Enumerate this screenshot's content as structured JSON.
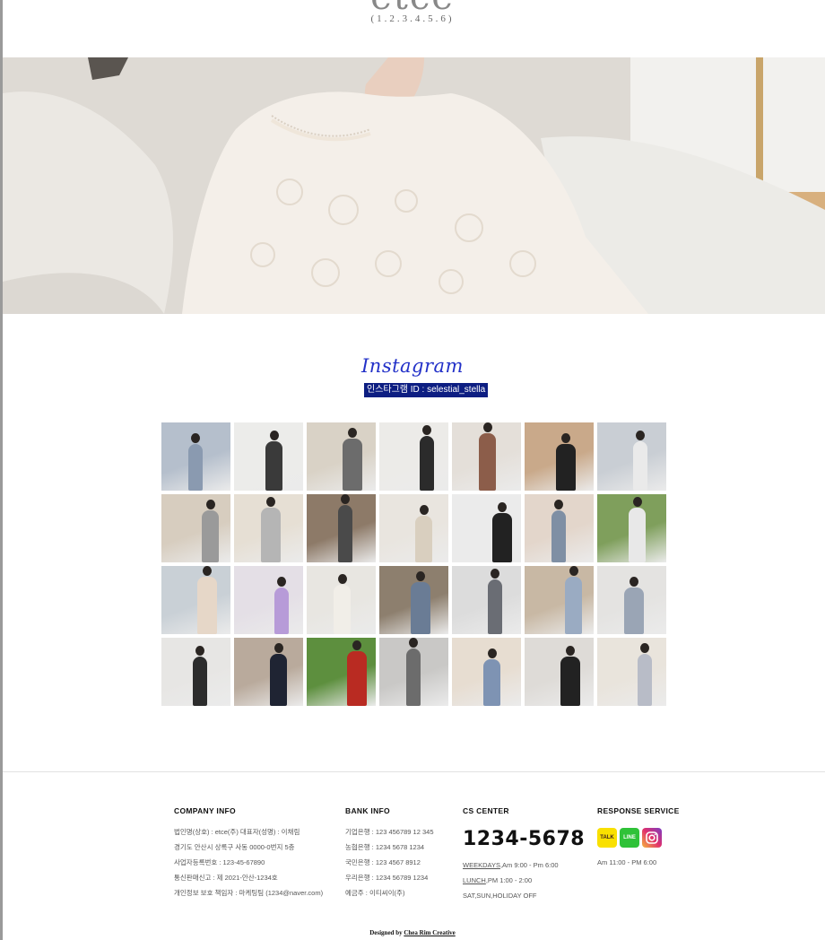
{
  "header": {
    "title": "etce",
    "subtitle": "(1.2.3.4.5.6)"
  },
  "hero": {
    "alt": "model in white lace blouse"
  },
  "instagram": {
    "title": "Instagram",
    "id_label": "인스타그램 ID : selestial_stella",
    "photos": [
      [
        "#b5bfcc",
        "#8a9ab0"
      ],
      [
        "#ececea",
        "#3a3a3a"
      ],
      [
        "#d9d2c6",
        "#6c6c6c"
      ],
      [
        "#ecebe8",
        "#2b2b2b"
      ],
      [
        "#e4dfd9",
        "#8c5d4a"
      ],
      [
        "#c9a98a",
        "#222"
      ],
      [
        "#c9ced4",
        "#eaeaea"
      ],
      [
        "#d7cdbf",
        "#9a9a9a"
      ],
      [
        "#e6dfd4",
        "#b5b5b5"
      ],
      [
        "#8d7a68",
        "#4a4a4a"
      ],
      [
        "#e9e5df",
        "#d9cfbf"
      ],
      [
        "#ebebeb",
        "#222"
      ],
      [
        "#e3d6cb",
        "#7f8fa4"
      ],
      [
        "#7f9f5c",
        "#e8e8e8"
      ],
      [
        "#c9d0d6",
        "#e6d7c8"
      ],
      [
        "#e4dfe6",
        "#b79bd8"
      ],
      [
        "#e8e6e1",
        "#f1eee8"
      ],
      [
        "#8d7f6e",
        "#6a7c95"
      ],
      [
        "#dcdcdc",
        "#6a6d74"
      ],
      [
        "#c8b8a4",
        "#9aabc2"
      ],
      [
        "#e4e3e1",
        "#9aa5b5"
      ],
      [
        "#e7e6e4",
        "#2c2c2c"
      ],
      [
        "#b9aa9c",
        "#1f2433"
      ],
      [
        "#5d8f3e",
        "#b92b22"
      ],
      [
        "#c9c8c6",
        "#6c6c6c"
      ],
      [
        "#e7ddd1",
        "#7e93b3"
      ],
      [
        "#dedbd7",
        "#222"
      ],
      [
        "#e9e4dc",
        "#b8bcc7"
      ]
    ]
  },
  "footer": {
    "company": {
      "title": "COMPANY INFO",
      "lines": [
        "법인명(상호) : etce(주) 대표자(성명) : 이채림",
        "경기도 안산시 상록구 사동 0000-0번지 5층",
        "사업자등록번호 : 123-45-67890",
        "통신판매신고 : 제 2021-안산-1234호",
        "개인정보 보호 책임자 : 마케팅팀 (1234@naver.com)"
      ]
    },
    "bank": {
      "title": "BANK INFO",
      "lines": [
        "기업은행 : 123 456789 12 345",
        "농협은행 : 1234 5678 1234",
        "국민은행 : 123 4567 8912",
        "우리은행 : 1234 56789 1234",
        "예금주 : 이티씨이(주)"
      ]
    },
    "cs": {
      "title": "CS CENTER",
      "phone": "1234-5678",
      "weekdays_label": "WEEKDAYS",
      "weekdays_time": ",Am 9:00 - Pm 6:00",
      "lunch_label": "LUNCH",
      "lunch_time": ",PM 1:00 - 2:00",
      "off": "SAT,SUN,HOLIDAY OFF"
    },
    "response": {
      "title": "RESPONSE SERVICE",
      "kakao_label": "TALK",
      "line_label": "LINE",
      "hours": "Am 11:00 - PM 6:00"
    },
    "designed_prefix": "Designed by ",
    "designed_by": "Chea Rim Creative"
  }
}
